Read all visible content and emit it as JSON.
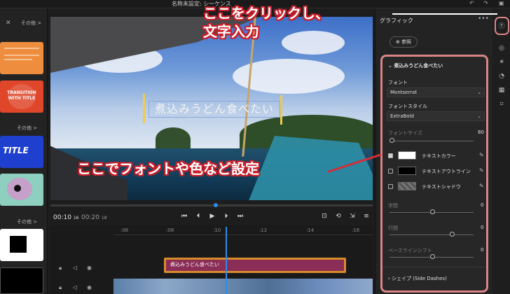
{
  "app": {
    "title": "名称未設定: シーケンス"
  },
  "left_panel": {
    "more_labels": [
      "その他 >",
      "その他 >",
      "その他 >"
    ],
    "templates": [
      {
        "name": "quote-template",
        "color": "#ef8d3f"
      },
      {
        "name": "transition-with-title",
        "text": "TRANSITION WITH TITLE",
        "color": "#e0472a"
      },
      {
        "name": "title-blue",
        "text": "TITLE",
        "color": "#1f3fcf"
      },
      {
        "name": "blob-template",
        "color": "#8ecfc0"
      },
      {
        "name": "black-square",
        "color": "#ffffff"
      },
      {
        "name": "black-card",
        "color": "#000000"
      }
    ]
  },
  "preview": {
    "title_text": "煮込みうどん食べたい"
  },
  "transport": {
    "current_time": "00:10",
    "current_frames": "16",
    "duration": "00:20",
    "duration_frames": "18"
  },
  "timeline": {
    "ticks": [
      ":06",
      ":08",
      ":10",
      ":12",
      ":14",
      ":16"
    ],
    "clip_label": "煮込みうどん食べたい"
  },
  "essential_graphics": {
    "tab": "グラフィック",
    "new_button": "参照",
    "layer_name": "煮込みうどん食べたい",
    "font_label": "フォント",
    "font_value": "Montserrat",
    "font_style_label": "フォントスタイル",
    "font_style_value": "ExtraBold",
    "font_size_label": "フォントサイズ",
    "font_size_value": "80",
    "text_color_label": "テキストカラー",
    "text_outline_label": "テキストアウトライン",
    "text_shadow_label": "テキストシャドウ",
    "tracking_label": "字間",
    "tracking_value": "0",
    "leading_label": "行間",
    "leading_value": "0",
    "baseline_label": "ベースラインシフト",
    "baseline_value": "0",
    "shape_label": "シェイプ (Side Dashes)",
    "text_color": "#ffffff",
    "outline_color": "#000000"
  },
  "annotations": {
    "click_note_line1": "ここをクリックし、",
    "click_note_line2": "文字入力",
    "settings_note": "ここでフォントや色など設定"
  },
  "colors": {
    "accent": "#2d8ceb",
    "annotation_red": "#d02e3a",
    "highlight_border": "#d98585"
  }
}
